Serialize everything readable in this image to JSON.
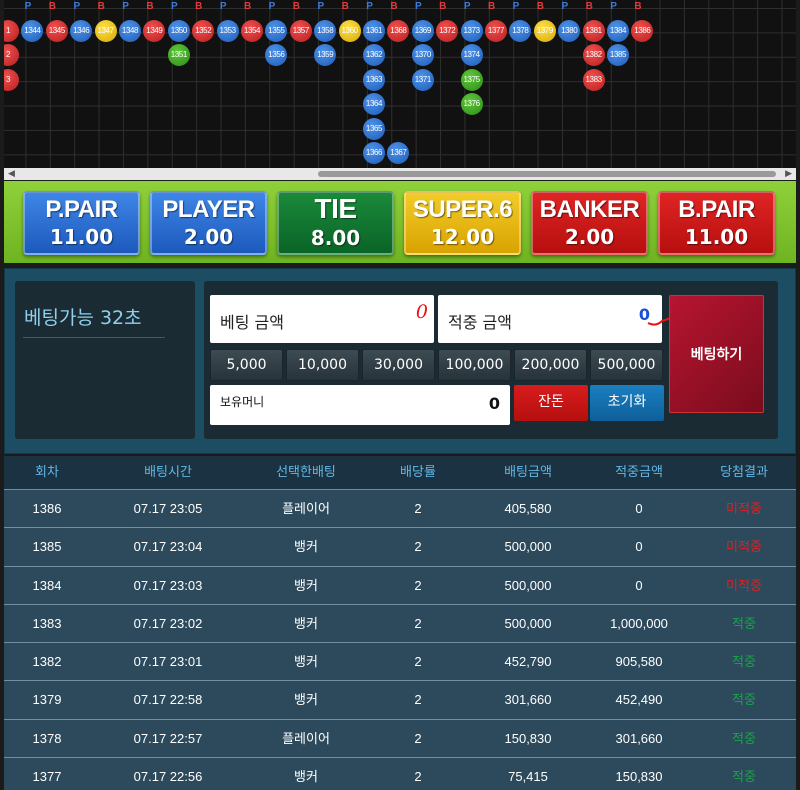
{
  "roadmap": {
    "pb_row": [
      "P",
      "B",
      "P",
      "B",
      "P",
      "B",
      "P",
      "B",
      "P",
      "B",
      "P",
      "B",
      "P",
      "B",
      "P",
      "B",
      "P",
      "B",
      "P",
      "B",
      "P",
      "B",
      "P",
      "B",
      "P",
      "B"
    ],
    "beads": [
      {
        "col": 0,
        "row": 0,
        "label": "1",
        "type": "B"
      },
      {
        "col": 0,
        "row": 1,
        "label": "2",
        "type": "B"
      },
      {
        "col": 0,
        "row": 2,
        "label": "3",
        "type": "B"
      },
      {
        "col": 1,
        "row": 0,
        "label": "1344",
        "type": "P"
      },
      {
        "col": 2,
        "row": 0,
        "label": "1345",
        "type": "B"
      },
      {
        "col": 3,
        "row": 0,
        "label": "1346",
        "type": "P"
      },
      {
        "col": 4,
        "row": 0,
        "label": "1347",
        "type": "S"
      },
      {
        "col": 5,
        "row": 0,
        "label": "1348",
        "type": "P"
      },
      {
        "col": 6,
        "row": 0,
        "label": "1349",
        "type": "B"
      },
      {
        "col": 7,
        "row": 0,
        "label": "1350",
        "type": "P"
      },
      {
        "col": 7,
        "row": 1,
        "label": "1351",
        "type": "T"
      },
      {
        "col": 8,
        "row": 0,
        "label": "1352",
        "type": "B"
      },
      {
        "col": 9,
        "row": 0,
        "label": "1353",
        "type": "P"
      },
      {
        "col": 10,
        "row": 0,
        "label": "1354",
        "type": "B"
      },
      {
        "col": 11,
        "row": 0,
        "label": "1355",
        "type": "P"
      },
      {
        "col": 11,
        "row": 1,
        "label": "1356",
        "type": "P"
      },
      {
        "col": 12,
        "row": 0,
        "label": "1357",
        "type": "B"
      },
      {
        "col": 13,
        "row": 0,
        "label": "1358",
        "type": "P"
      },
      {
        "col": 13,
        "row": 1,
        "label": "1359",
        "type": "P"
      },
      {
        "col": 14,
        "row": 0,
        "label": "1360",
        "type": "S"
      },
      {
        "col": 15,
        "row": 0,
        "label": "1361",
        "type": "P"
      },
      {
        "col": 15,
        "row": 1,
        "label": "1362",
        "type": "P"
      },
      {
        "col": 15,
        "row": 2,
        "label": "1363",
        "type": "P"
      },
      {
        "col": 15,
        "row": 3,
        "label": "1364",
        "type": "P"
      },
      {
        "col": 15,
        "row": 4,
        "label": "1365",
        "type": "P"
      },
      {
        "col": 15,
        "row": 5,
        "label": "1366",
        "type": "P"
      },
      {
        "col": 16,
        "row": 5,
        "label": "1367",
        "type": "P"
      },
      {
        "col": 16,
        "row": 0,
        "label": "1368",
        "type": "B"
      },
      {
        "col": 17,
        "row": 0,
        "label": "1369",
        "type": "P"
      },
      {
        "col": 17,
        "row": 1,
        "label": "1370",
        "type": "P"
      },
      {
        "col": 17,
        "row": 2,
        "label": "1371",
        "type": "P"
      },
      {
        "col": 18,
        "row": 0,
        "label": "1372",
        "type": "B"
      },
      {
        "col": 19,
        "row": 0,
        "label": "1373",
        "type": "P"
      },
      {
        "col": 19,
        "row": 1,
        "label": "1374",
        "type": "P"
      },
      {
        "col": 19,
        "row": 2,
        "label": "1375",
        "type": "T"
      },
      {
        "col": 19,
        "row": 3,
        "label": "1376",
        "type": "T"
      },
      {
        "col": 20,
        "row": 0,
        "label": "1377",
        "type": "B"
      },
      {
        "col": 21,
        "row": 0,
        "label": "1378",
        "type": "P"
      },
      {
        "col": 22,
        "row": 0,
        "label": "1379",
        "type": "S"
      },
      {
        "col": 23,
        "row": 0,
        "label": "1380",
        "type": "P"
      },
      {
        "col": 24,
        "row": 0,
        "label": "1381",
        "type": "B"
      },
      {
        "col": 24,
        "row": 1,
        "label": "1382",
        "type": "B"
      },
      {
        "col": 24,
        "row": 2,
        "label": "1383",
        "type": "B"
      },
      {
        "col": 25,
        "row": 0,
        "label": "1384",
        "type": "P"
      },
      {
        "col": 25,
        "row": 1,
        "label": "1385",
        "type": "P"
      },
      {
        "col": 26,
        "row": 0,
        "label": "1386",
        "type": "B"
      }
    ],
    "scroll_left": "◀",
    "scroll_right": "▶"
  },
  "odds": [
    {
      "name": "P.PAIR",
      "rate": "11.00",
      "color": "c-blue"
    },
    {
      "name": "PLAYER",
      "rate": "2.00",
      "color": "c-blue"
    },
    {
      "name": "TIE",
      "rate": "8.00",
      "color": "c-green"
    },
    {
      "name": "SUPER.6",
      "rate": "12.00",
      "color": "c-yellow"
    },
    {
      "name": "BANKER",
      "rate": "2.00",
      "color": "c-red"
    },
    {
      "name": "B.PAIR",
      "rate": "11.00",
      "color": "c-red"
    }
  ],
  "bet": {
    "timer": "베팅가능 32초",
    "bet_amount_label": "베팅 금액",
    "bet_amount_note": "0",
    "win_amount_label": "적중 금액",
    "win_amount_value": "0",
    "chips": [
      "5,000",
      "10,000",
      "30,000",
      "100,000",
      "200,000",
      "500,000"
    ],
    "money_label": "보유머니",
    "money_value": "0",
    "remaining_label": "잔돈",
    "reset_label": "초기화",
    "submit_label": "베팅하기"
  },
  "history": {
    "headers": [
      "회차",
      "배팅시간",
      "선택한배팅",
      "배당률",
      "배팅금액",
      "적중금액",
      "당첨결과"
    ],
    "rows": [
      {
        "round": "1386",
        "time": "07.17 23:05",
        "pick": "플레이어",
        "odds": "2",
        "amount": "405,580",
        "win": "0",
        "result": "미적중",
        "status": "lose"
      },
      {
        "round": "1385",
        "time": "07.17 23:04",
        "pick": "뱅커",
        "odds": "2",
        "amount": "500,000",
        "win": "0",
        "result": "미적중",
        "status": "lose"
      },
      {
        "round": "1384",
        "time": "07.17 23:03",
        "pick": "뱅커",
        "odds": "2",
        "amount": "500,000",
        "win": "0",
        "result": "미적중",
        "status": "lose"
      },
      {
        "round": "1383",
        "time": "07.17 23:02",
        "pick": "뱅커",
        "odds": "2",
        "amount": "500,000",
        "win": "1,000,000",
        "result": "적중",
        "status": "win"
      },
      {
        "round": "1382",
        "time": "07.17 23:01",
        "pick": "뱅커",
        "odds": "2",
        "amount": "452,790",
        "win": "905,580",
        "result": "적중",
        "status": "win"
      },
      {
        "round": "1379",
        "time": "07.17 22:58",
        "pick": "뱅커",
        "odds": "2",
        "amount": "301,660",
        "win": "452,490",
        "result": "적중",
        "status": "win"
      },
      {
        "round": "1378",
        "time": "07.17 22:57",
        "pick": "플레이어",
        "odds": "2",
        "amount": "150,830",
        "win": "301,660",
        "result": "적중",
        "status": "win"
      },
      {
        "round": "1377",
        "time": "07.17 22:56",
        "pick": "뱅커",
        "odds": "2",
        "amount": "75,415",
        "win": "150,830",
        "result": "적중",
        "status": "win"
      }
    ]
  }
}
